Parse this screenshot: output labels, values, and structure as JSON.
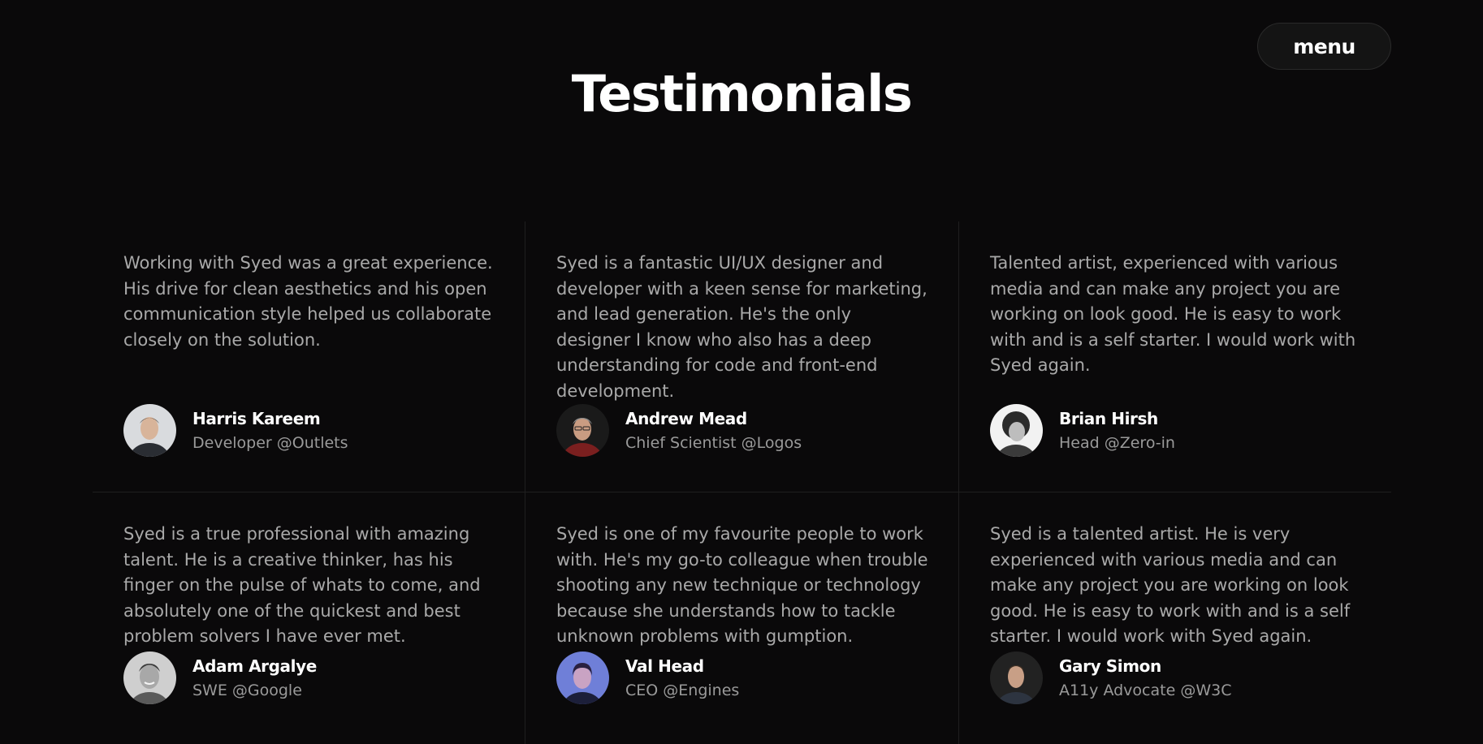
{
  "header": {
    "menu_label": "menu",
    "title": "Testimonials"
  },
  "testimonials": [
    {
      "quote": "Working with Syed was a great experience. His drive for clean aesthetics and his open communication style helped us collaborate closely on the solution.",
      "name": "Harris Kareem",
      "role": "Developer @Outlets",
      "avatar_icon": "person-avatar-icon"
    },
    {
      "quote": "Syed is a fantastic UI/UX designer and developer with a keen sense for marketing, and lead generation. He's the only designer I know who also has a deep understanding for code and front-end development.",
      "name": "Andrew Mead",
      "role": "Chief Scientist @Logos",
      "avatar_icon": "person-avatar-icon"
    },
    {
      "quote": "Talented artist, experienced with various media and can make any project you are working on look good. He is easy to work with and is a self starter. I would work with Syed again.",
      "name": "Brian Hirsh",
      "role": "Head @Zero-in",
      "avatar_icon": "person-avatar-icon"
    },
    {
      "quote": "Syed is a true professional with amazing talent. He is a creative thinker, has his finger on the pulse of whats to come, and absolutely one of the quickest and best problem solvers I have ever met.",
      "name": "Adam Argalye",
      "role": "SWE @Google",
      "avatar_icon": "person-avatar-icon"
    },
    {
      "quote": "Syed is one of my favourite people to work with. He's my go-to colleague when trouble shooting any new technique or technology because she understands how to tackle unknown problems with gumption.",
      "name": "Val Head",
      "role": "CEO @Engines",
      "avatar_icon": "person-avatar-icon"
    },
    {
      "quote": "Syed is a talented artist. He is very experienced with various media and can make any project you are working on look good. He is easy to work with and is a self starter. I would work with Syed again.",
      "name": "Gary Simon",
      "role": "A11y Advocate @W3C",
      "avatar_icon": "person-avatar-icon"
    }
  ],
  "colors": {
    "background": "#0a090a",
    "title": "#ffffff",
    "quote_text": "#a9a9a9",
    "role_text": "#9a9a9a",
    "divider": "#1f1f1f",
    "menu_bg": "#141414"
  }
}
